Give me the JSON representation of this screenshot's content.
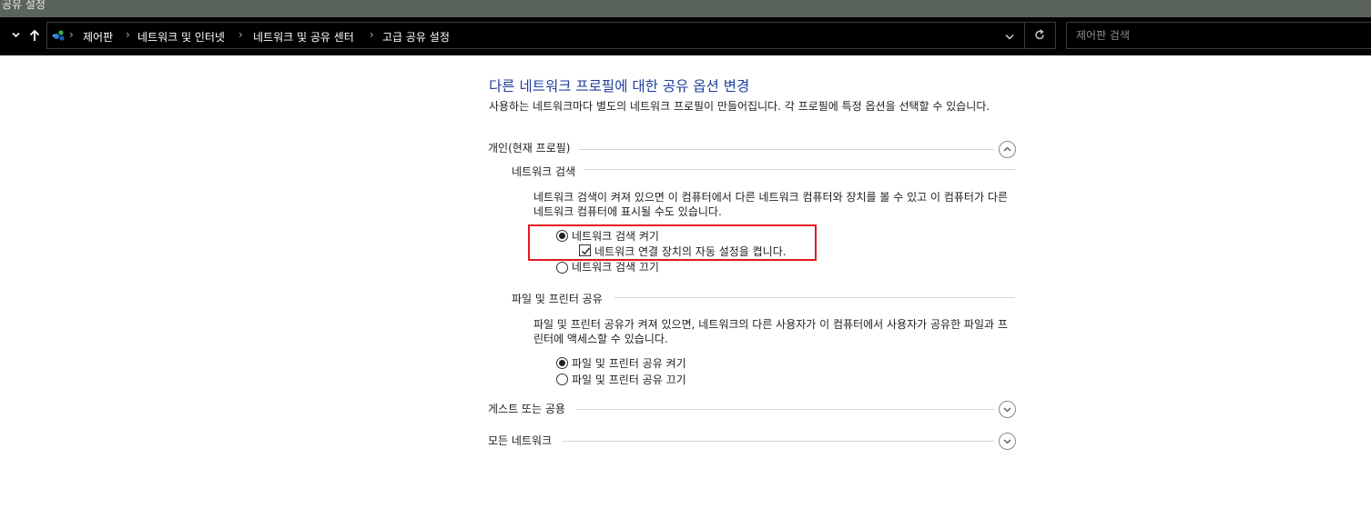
{
  "window": {
    "title": "공유 설정"
  },
  "nav": {
    "breadcrumbs": [
      "제어판",
      "네트워크 및 인터넷",
      "네트워크 및 공유 센터",
      "고급 공유 설정"
    ],
    "search_placeholder": "제어판 검색"
  },
  "page": {
    "title": "다른 네트워크 프로필에 대한 공유 옵션 변경",
    "description": "사용하는 네트워크마다 별도의 네트워크 프로필이 만들어집니다. 각 프로필에 특정 옵션을 선택할 수 있습니다."
  },
  "profiles": {
    "private": {
      "label": "개인(현재 프로필)",
      "expanded": true,
      "network_discovery": {
        "label": "네트워크 검색",
        "description": "네트워크 검색이 켜져 있으면 이 컴퓨터에서 다른 네트워크 컴퓨터와 장치를 볼 수 있고 이 컴퓨터가 다른 네트워크 컴퓨터에 표시될 수도 있습니다.",
        "on_label": "네트워크 검색 켜기",
        "auto_setup_label": "네트워크 연결 장치의 자동 설정을 켭니다.",
        "off_label": "네트워크 검색 끄기",
        "selected": "on",
        "auto_setup_checked": true
      },
      "file_sharing": {
        "label": "파일 및 프린터 공유",
        "description": "파일 및 프린터 공유가 켜져 있으면, 네트워크의 다른 사용자가 이 컴퓨터에서 사용자가 공유한 파일과 프린터에 액세스할 수 있습니다.",
        "on_label": "파일 및 프린터 공유 켜기",
        "off_label": "파일 및 프린터 공유 끄기",
        "selected": "on"
      }
    },
    "guest": {
      "label": "게스트 또는 공용",
      "expanded": false
    },
    "all": {
      "label": "모든 네트워크",
      "expanded": false
    }
  },
  "colors": {
    "title_blue": "#1e3f9a",
    "highlight_red": "#e3171e",
    "titlebar": "#5a645c"
  }
}
